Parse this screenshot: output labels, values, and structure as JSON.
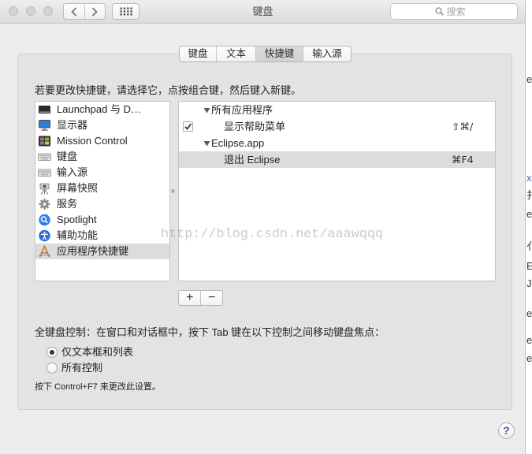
{
  "window": {
    "title": "键盘",
    "search_placeholder": "搜索"
  },
  "toolbar": {
    "back_icon": "chevron-left-icon",
    "forward_icon": "chevron-right-icon",
    "show_all_icon": "grid-icon",
    "search_icon": "search-icon"
  },
  "tabs": [
    {
      "label": "键盘",
      "selected": false
    },
    {
      "label": "文本",
      "selected": false
    },
    {
      "label": "快捷键",
      "selected": true
    },
    {
      "label": "输入源",
      "selected": false
    }
  ],
  "shortcuts_pane": {
    "instruction": "若要更改快捷键，请选择它，点按组合键，然后键入新键。",
    "categories": [
      {
        "label": "Launchpad 与 D…",
        "icon": "launchpad-icon",
        "selected": false
      },
      {
        "label": "显示器",
        "icon": "display-icon",
        "selected": false
      },
      {
        "label": "Mission Control",
        "icon": "mission-control-icon",
        "selected": false
      },
      {
        "label": "键盘",
        "icon": "keyboard-icon",
        "selected": false
      },
      {
        "label": "输入源",
        "icon": "input-source-icon",
        "selected": false
      },
      {
        "label": "屏幕快照",
        "icon": "screenshot-icon",
        "selected": false
      },
      {
        "label": "服务",
        "icon": "services-icon",
        "selected": false
      },
      {
        "label": "Spotlight",
        "icon": "spotlight-icon",
        "selected": false
      },
      {
        "label": "辅助功能",
        "icon": "accessibility-icon",
        "selected": false
      },
      {
        "label": "应用程序快捷键",
        "icon": "app-shortcuts-icon",
        "selected": true
      }
    ],
    "shortcuts": [
      {
        "is_group": true,
        "expanded": true,
        "label": "所有应用程序"
      },
      {
        "is_group": false,
        "has_checkbox": true,
        "checked": true,
        "label": "显示帮助菜单",
        "keys": "⇧⌘/",
        "selected": false
      },
      {
        "is_group": true,
        "expanded": true,
        "label": "Eclipse.app"
      },
      {
        "is_group": false,
        "has_checkbox": false,
        "checked": false,
        "label": "退出 Eclipse",
        "keys": "⌘F4",
        "selected": true
      }
    ],
    "add_label": "+",
    "remove_label": "−"
  },
  "keyboard_access": {
    "description": "全键盘控制：在窗口和对话框中，按下 Tab 键在以下控制之间移动键盘焦点：",
    "options": [
      {
        "label": "仅文本框和列表",
        "selected": true
      },
      {
        "label": "所有控制",
        "selected": false
      }
    ],
    "hint": "按下 Control+F7 来更改此设置。"
  },
  "help_label": "?",
  "watermark": "http://blog.csdn.net/aaawqqq",
  "background_window_fragments": [
    "e",
    "xu",
    "扌",
    "e",
    "亻",
    "E",
    "Ju",
    "e",
    "e",
    "e"
  ],
  "colors": {
    "window_bg": "#ececec",
    "panel_bg": "#e3e3e3",
    "selection": "#dcdcdc",
    "list_bg": "#ffffff"
  }
}
